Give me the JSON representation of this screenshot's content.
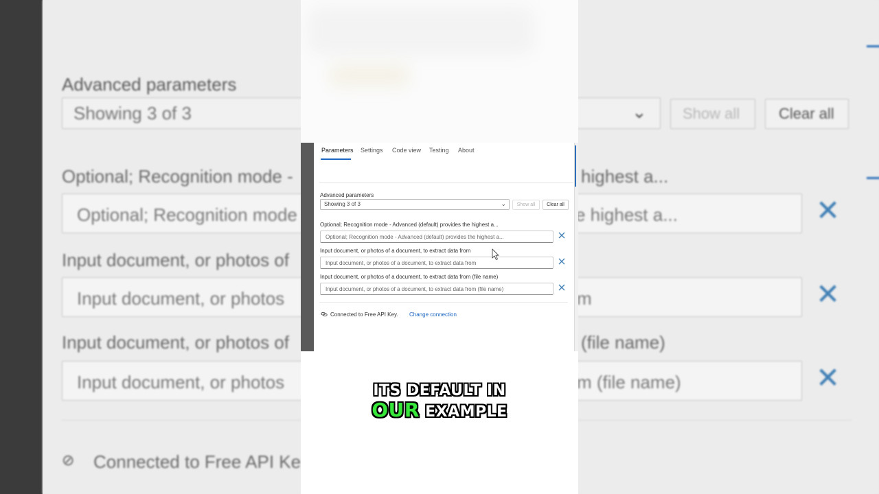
{
  "tabs": [
    {
      "label": "Parameters",
      "active": true
    },
    {
      "label": "Settings",
      "active": false
    },
    {
      "label": "Code view",
      "active": false
    },
    {
      "label": "Testing",
      "active": false
    },
    {
      "label": "About",
      "active": false
    }
  ],
  "advanced": {
    "label": "Advanced parameters",
    "select_value": "Showing 3 of 3",
    "show_all": "Show all",
    "clear_all": "Clear all"
  },
  "params": [
    {
      "label": "Optional; Recognition mode - Advanced (default) provides the highest a...",
      "placeholder": "Optional; Recognition mode - Advanced (default) provides the highest a..."
    },
    {
      "label": "Input document, or photos of a document, to extract data from",
      "placeholder": "Input document, or photos of a document, to extract data from"
    },
    {
      "label": "Input document, or photos of a document, to extract data from (file name)",
      "placeholder": "Input document, or photos of a document, to extract data from (file name)"
    }
  ],
  "connection": {
    "text": "Connected to Free API Key.",
    "change_link": "Change connection"
  },
  "caption": {
    "line1": "its default in",
    "highlight": "our",
    "line2_rest": "example"
  },
  "background": {
    "advanced_label": "Advanced parameters",
    "select_value": "Showing 3 of 3",
    "show_all": "Show all",
    "clear_all": "Clear all",
    "label1": "Optional; Recognition mode -",
    "label1_right": "highest a...",
    "input1": "Optional; Recognition mode",
    "input1_right": "e highest a...",
    "label2": "Input document, or photos of",
    "input2": "Input document, or photos",
    "input2_right": "m",
    "label3": "Input document, or photos of",
    "label3_right": "(file name)",
    "input3": "Input document, or photos",
    "input3_right": "m (file name)",
    "connection": "Connected to Free API Ke"
  },
  "colors": {
    "accent": "#1a66c2",
    "caption_highlight": "#37e83a",
    "close_x": "#3f7fb5"
  }
}
